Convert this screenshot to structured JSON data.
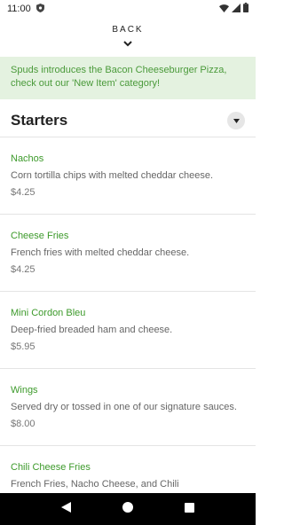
{
  "status_bar": {
    "time": "11:00"
  },
  "nav": {
    "back_label": "BACK"
  },
  "banner": {
    "text": "Spuds introduces the Bacon Cheeseburger Pizza, check out our 'New Item' category!"
  },
  "section": {
    "title": "Starters"
  },
  "items": [
    {
      "name": "Nachos",
      "description": "Corn tortilla chips with melted cheddar cheese.",
      "price": "$4.25"
    },
    {
      "name": "Cheese Fries",
      "description": "French fries with melted cheddar cheese.",
      "price": "$4.25"
    },
    {
      "name": "Mini Cordon Bleu",
      "description": "Deep-fried breaded ham and cheese.",
      "price": "$5.95"
    },
    {
      "name": "Wings",
      "description": "Served dry or tossed in one of our signature sauces.",
      "price": "$8.00"
    },
    {
      "name": "Chili Cheese Fries",
      "description": "French Fries, Nacho Cheese, and Chili",
      "price": ""
    }
  ],
  "colors": {
    "accent_green": "#3d9a2b",
    "banner_bg": "#e4f2e0"
  },
  "icons": {
    "status": [
      "shield-icon",
      "wifi-icon",
      "cell-signal-icon",
      "battery-icon"
    ],
    "nav": [
      "back-triangle-icon",
      "home-circle-icon",
      "recents-square-icon"
    ]
  }
}
